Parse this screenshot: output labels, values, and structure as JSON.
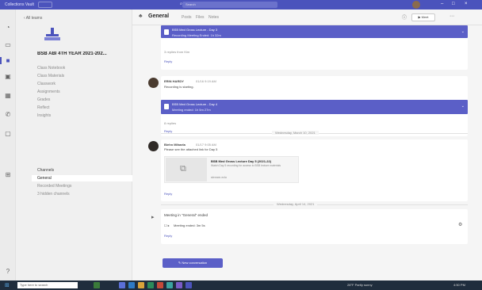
{
  "titlebar": {
    "app_name": "Collections Vault",
    "search_placeholder": "Search"
  },
  "team_panel": {
    "back_label": "All teams",
    "team_name": "BSB ABI 4TH YEAR 2021-202...",
    "nav_links": [
      "Class Notebook",
      "Class Materials",
      "Classwork",
      "Assignments",
      "Grades",
      "Reflect",
      "Insights"
    ],
    "section_label": "Channels",
    "channels": [
      "General",
      "Recorded Meetings",
      "3 hidden channels"
    ]
  },
  "chat_header": {
    "channel": "General",
    "tabs": [
      "Posts",
      "Files",
      "Notes"
    ],
    "meet_label": "Meet"
  },
  "messages": [
    {
      "card_title": "BSB Med Gross Lecture - Day 3",
      "card_subtitle": "Recording Meeting Ended: 1h 32m",
      "meta": "3 replies from Kim",
      "reply": "Reply"
    },
    {
      "sender": "ERIN HARDY",
      "timestamp": "01/16 9:19 AM",
      "line": "Recording is starting.",
      "card_title": "BSB Med Gross Lecture - Day 4",
      "card_subtitle": "Meeting ended: 1h 5m 27m",
      "meta": "8 replies",
      "reply": "Reply"
    },
    {
      "sender": "Biehn Mihaela",
      "timestamp": "01/17 9:05 AM",
      "line": "Please see the attached link for Day 5 ",
      "link_title": "BSB Med Gross Lecture Day 5 (2021-22)",
      "link_desc": "Watch Day 5 recording for access to BSB lecture materials",
      "link_source": "stream.edu",
      "reply": "Reply"
    },
    {
      "meeting_title": "Meeting in \"General\" ended",
      "meeting_sub": "Meeting ended: 3m 5s",
      "reply": "Reply"
    }
  ],
  "dividers": [
    "Wednesday, March 10, 2021",
    "Wednesday, April 14, 2021"
  ],
  "new_conversation_label": "New conversation",
  "taskbar": {
    "search_placeholder": "Type here to search",
    "tray_text": "28°F Partly sunny",
    "clock": "4:50 PM"
  }
}
